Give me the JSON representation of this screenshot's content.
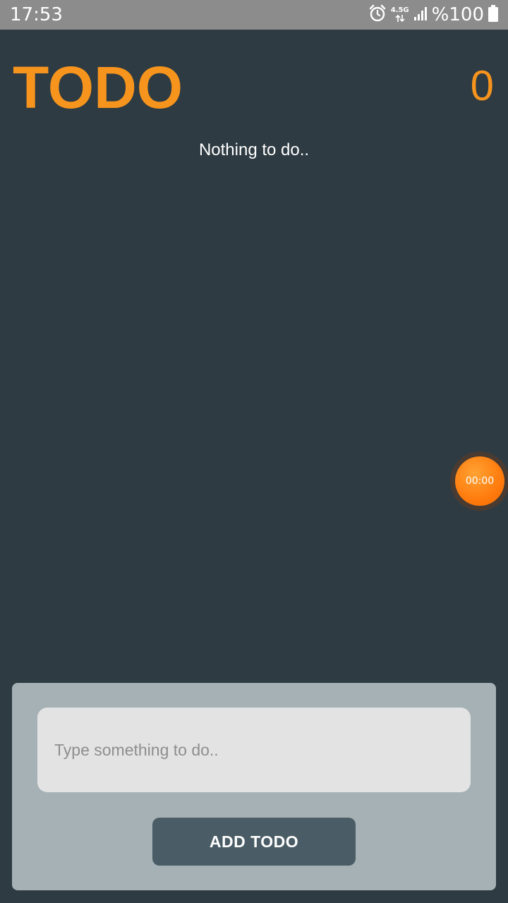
{
  "status_bar": {
    "time": "17:53",
    "network_label": "4.5G",
    "battery_text": "%100",
    "icons": [
      "alarm-icon",
      "network-arrows-icon",
      "signal-icon",
      "battery-icon"
    ]
  },
  "header": {
    "title": "TODO",
    "count": "0"
  },
  "list": {
    "empty_message": "Nothing to do.."
  },
  "timer": {
    "label": "00:00"
  },
  "composer": {
    "input_value": "",
    "input_placeholder": "Type something to do..",
    "add_button_label": "ADD TODO"
  },
  "colors": {
    "accent": "#f7941d",
    "background": "#2e3b42",
    "panel": "#a6b1b5",
    "button": "#4a5d66",
    "timer": "#ff7b0d"
  }
}
